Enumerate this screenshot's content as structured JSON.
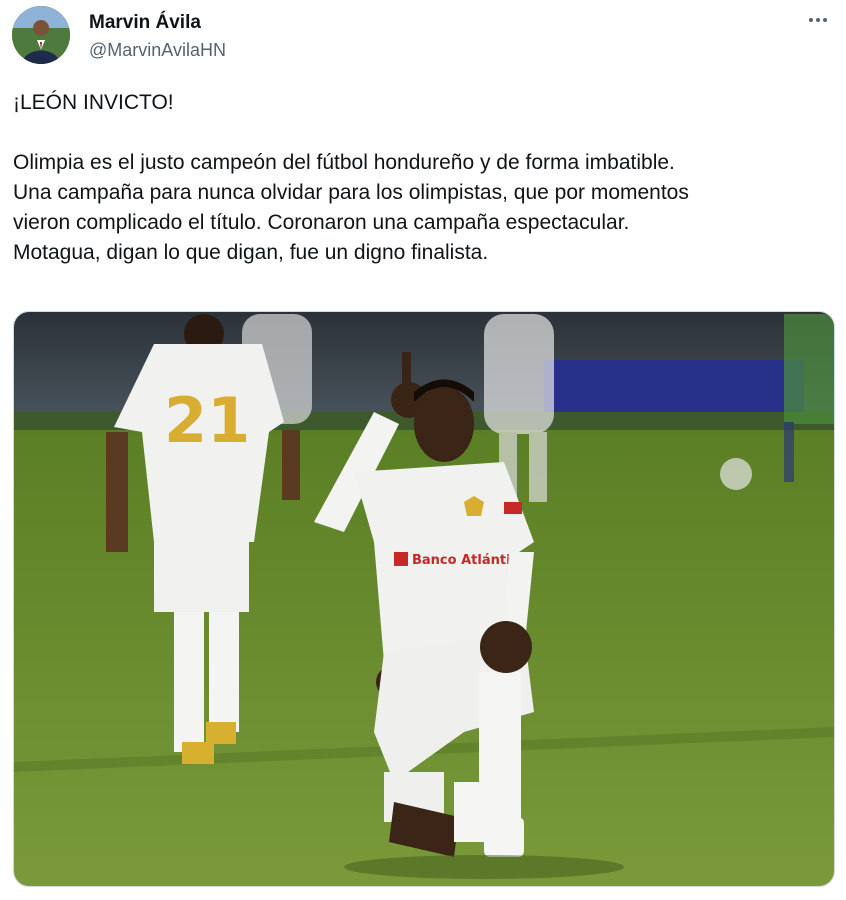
{
  "author": {
    "display_name": "Marvin Ávila",
    "handle": "@MarvinAvilaHN"
  },
  "menu": {
    "more_icon": "more-horizontal-icon"
  },
  "tweet": {
    "lines": [
      "¡LEÓN INVICTO!",
      "",
      "Olimpia es el justo campeón del fútbol hondureño y de forma imbatible.",
      "Una campaña para nunca olvidar para los olimpistas, que por momentos",
      "vieron complicado el título. Coronaron una campaña espectacular.",
      "Motagua, digan lo que digan, fue un digno finalista."
    ]
  },
  "media": {
    "jersey_number": "21",
    "sponsor_text": "Banco Atlántida"
  },
  "colors": {
    "text": "#0f1419",
    "secondary": "#536471",
    "pitch": "#6b8b2f",
    "kit": "#f1f1ef",
    "accent_red": "#c62828",
    "number_gold": "#d8ad32"
  }
}
